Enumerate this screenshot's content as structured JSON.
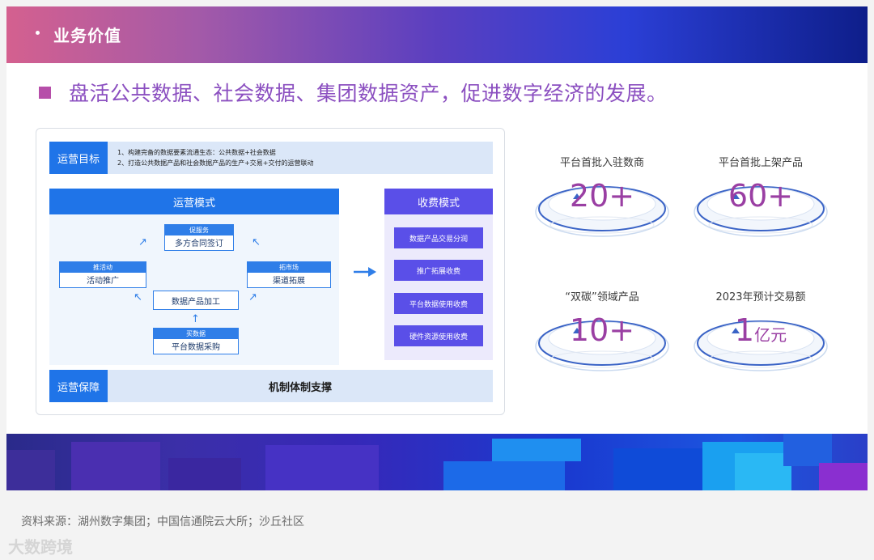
{
  "header": {
    "title": "业务价值"
  },
  "headline": "盘活公共数据、社会数据、集团数据资产，促进数字经济的发展。",
  "diagram": {
    "goal": {
      "tag": "运营目标",
      "lines": [
        "1、构建完备的数据要素流通生态：公共数据+社会数据",
        "2、打造公共数据产品和社会数据产品的生产+交易+交付的运营联动"
      ]
    },
    "mode": {
      "title": "运营模式",
      "nodes": {
        "top": {
          "tab": "促服务",
          "label": "多方合同签订"
        },
        "left": {
          "tab": "推活动",
          "label": "活动推广"
        },
        "right": {
          "tab": "拓市场",
          "label": "渠道拓展"
        },
        "center": {
          "label": "数据产品加工"
        },
        "bottom": {
          "tab": "买数据",
          "label": "平台数据采购"
        }
      }
    },
    "fee": {
      "title": "收费模式",
      "items": [
        "数据产品交易分润",
        "推广拓展收费",
        "平台数据使用收费",
        "硬件资源使用收费"
      ]
    },
    "guarantee": {
      "tag": "运营保障",
      "text": "机制体制支撑"
    }
  },
  "stats": [
    {
      "caption": "平台首批入驻数商",
      "value": "20+",
      "unit": ""
    },
    {
      "caption": "平台首批上架产品",
      "value": "60+",
      "unit": ""
    },
    {
      "caption": "“双碳”领域产品",
      "value": "10+",
      "unit": ""
    },
    {
      "caption": "2023年预计交易额",
      "value": "1",
      "unit": "亿元"
    }
  ],
  "footer": {
    "source": "资料来源：湖州数字集团；中国信通院云大所；沙丘社区",
    "watermark": "大数跨境"
  },
  "colors": {
    "accent_blue": "#1f74e8",
    "accent_purple": "#5a4fe8",
    "value_purple": "#9a3fa3",
    "headline_purple": "#8b4fc0"
  }
}
